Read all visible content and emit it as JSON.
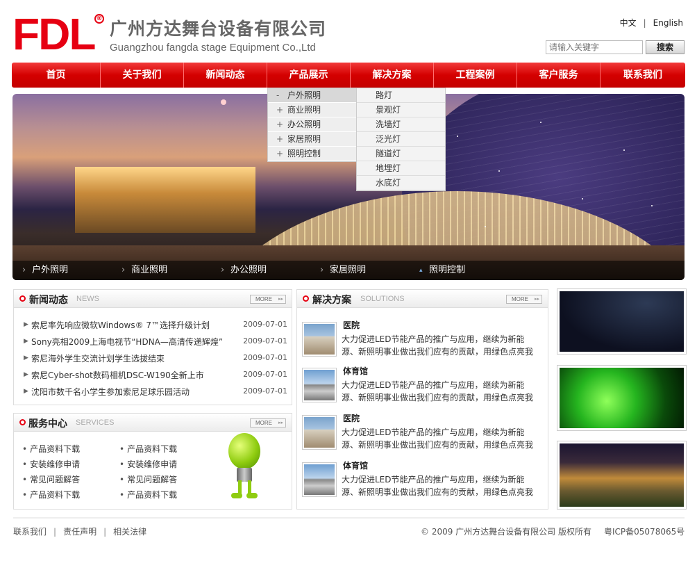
{
  "header": {
    "logo_text": "FDL",
    "logo_mark": "®",
    "company_name": "广州方达舞台设备有限公司",
    "company_name_en": "Guangzhou fangda stage Equipment Co.,Ltd",
    "lang_cn": "中文",
    "lang_sep": "|",
    "lang_en": "English",
    "search_placeholder": "请输入关键字",
    "search_button": "搜索"
  },
  "nav": [
    {
      "label": "首页"
    },
    {
      "label": "关于我们"
    },
    {
      "label": "新闻动态"
    },
    {
      "label": "产品展示"
    },
    {
      "label": "解决方案"
    },
    {
      "label": "工程案例"
    },
    {
      "label": "客户服务"
    },
    {
      "label": "联系我们"
    }
  ],
  "dropdown": {
    "categories": [
      {
        "sign": "-",
        "label": "户外照明"
      },
      {
        "sign": "+",
        "label": "商业照明"
      },
      {
        "sign": "+",
        "label": "办公照明"
      },
      {
        "sign": "+",
        "label": "家居照明"
      },
      {
        "sign": "+",
        "label": "照明控制"
      }
    ],
    "sub_items": [
      "路灯",
      "景观灯",
      "洗墙灯",
      "泛光灯",
      "隧道灯",
      "地埋灯",
      "水底灯"
    ]
  },
  "banner": {
    "tabs": [
      "户外照明",
      "商业照明",
      "办公照明",
      "家居照明",
      "照明控制"
    ]
  },
  "news": {
    "title": "新闻动态",
    "title_en": "NEWS",
    "more": "MORE",
    "items": [
      {
        "text": "索尼率先响应微软Windows® 7™选择升级计划",
        "date": "2009-07-01"
      },
      {
        "text": "Sony亮相2009上海电视节“HDNA—高清传递辉煌”",
        "date": "2009-07-01"
      },
      {
        "text": "索尼海外学生交流计划学生选拔结束",
        "date": "2009-07-01"
      },
      {
        "text": "索尼Cyber-shot数码相机DSC-W190全新上市",
        "date": "2009-07-01"
      },
      {
        "text": "沈阳市数千名小学生参加索尼足球乐园活动",
        "date": "2009-07-01"
      }
    ]
  },
  "services": {
    "title": "服务中心",
    "title_en": "SERVICES",
    "more": "MORE",
    "col1": [
      "产品资料下载",
      "安装维修申请",
      "常见问题解答",
      "产品资料下载"
    ],
    "col2": [
      "产品资料下载",
      "安装维修申请",
      "常见问题解答",
      "产品资料下载"
    ]
  },
  "solutions": {
    "title": "解决方案",
    "title_en": "SOLUTIONS",
    "more": "MORE",
    "items": [
      {
        "title": "医院",
        "desc": "大力促进LED节能产品的推广与应用，继续为新能源、新照明事业做出我们应有的贡献，用绿色点亮我"
      },
      {
        "title": "体育馆",
        "desc": "大力促进LED节能产品的推广与应用，继续为新能源、新照明事业做出我们应有的贡献，用绿色点亮我"
      },
      {
        "title": "医院",
        "desc": "大力促进LED节能产品的推广与应用，继续为新能源、新照明事业做出我们应有的贡献，用绿色点亮我"
      },
      {
        "title": "体育馆",
        "desc": "大力促进LED节能产品的推广与应用，继续为新能源、新照明事业做出我们应有的贡献，用绿色点亮我"
      }
    ]
  },
  "footer": {
    "links": [
      "联系我们",
      "责任声明",
      "相关法律"
    ],
    "copyright": "© 2009 广州方达舞台设备有限公司  版权所有",
    "icp": "粤ICP备05078065号"
  },
  "colors": {
    "brand_red": "#e60012",
    "nav_red": "#d40000"
  }
}
